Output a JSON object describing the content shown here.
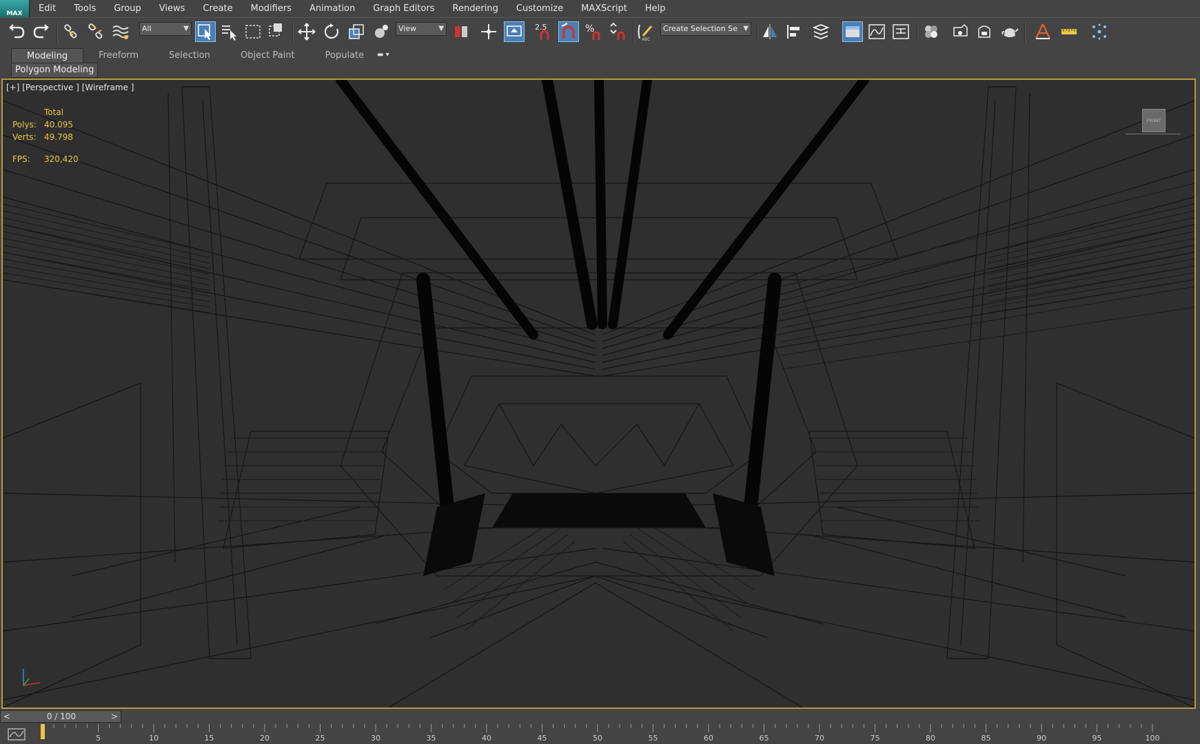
{
  "app": {
    "logo_text": "MAX"
  },
  "menu": [
    "Edit",
    "Tools",
    "Group",
    "Views",
    "Create",
    "Modifiers",
    "Animation",
    "Graph Editors",
    "Rendering",
    "Customize",
    "MAXScript",
    "Help"
  ],
  "toolbar": {
    "selection_filter": "All",
    "reference_coord": "View",
    "snap_label": "2.5",
    "named_selection_placeholder": "Create Selection Se"
  },
  "ribbon": {
    "tabs": [
      "Modeling",
      "Freeform",
      "Selection",
      "Object Paint",
      "Populate"
    ],
    "active_tab": "Modeling",
    "panel_label": "Polygon Modeling"
  },
  "viewport": {
    "label": "[+] [Perspective ] [Wireframe ]",
    "stats": {
      "header": "Total",
      "polys_label": "Polys:",
      "polys_value": "40.095",
      "verts_label": "Verts:",
      "verts_value": "49.798",
      "fps_label": "FPS:",
      "fps_value": "320,420"
    },
    "viewcube_label": "FRONT"
  },
  "timeline": {
    "frame_label": "0 / 100",
    "prev_symbol": "<",
    "next_symbol": ">",
    "ticks": [
      "5",
      "10",
      "15",
      "20",
      "25",
      "30",
      "35",
      "40",
      "45",
      "50",
      "55",
      "60",
      "65",
      "70",
      "75",
      "80",
      "85",
      "90",
      "95",
      "100"
    ]
  },
  "colors": {
    "viewport_border": "#b59a3c",
    "stats_text": "#e8c840",
    "active_button": "#4a7fb5"
  }
}
